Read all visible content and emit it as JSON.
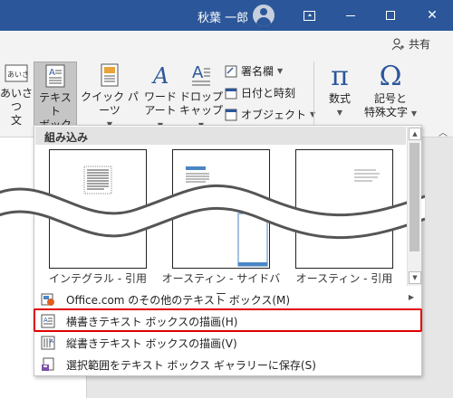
{
  "titlebar": {
    "user_name": "秋葉 一郎",
    "bg_color": "#2b579a"
  },
  "share": {
    "label": "共有",
    "icon": "person-add-icon"
  },
  "ribbon": {
    "buttons": [
      {
        "line1": "あいさつ",
        "line2": "文",
        "icon": "greeting-icon"
      },
      {
        "line1": "テキスト",
        "line2": "ボックス",
        "icon": "textbox-icon"
      },
      {
        "line1": "クイック パーツ",
        "line2": "",
        "icon": "quick-parts-icon"
      },
      {
        "line1": "ワード",
        "line2": "アート",
        "icon": "wordart-icon"
      },
      {
        "line1": "ドロップ",
        "line2": "キャップ",
        "icon": "dropcap-icon"
      }
    ],
    "small": [
      {
        "label": "署名欄",
        "icon": "signature-icon"
      },
      {
        "label": "日付と時刻",
        "icon": "calendar-icon"
      },
      {
        "label": "オブジェクト",
        "icon": "object-icon"
      }
    ],
    "equation": {
      "symbol": "π",
      "label": "数式"
    },
    "symbol": {
      "symbol": "Ω",
      "line1": "記号と",
      "line2": "特殊文字"
    }
  },
  "dropdown": {
    "header": "組み込み",
    "gallery": [
      {
        "label": "インテグラル - 引用"
      },
      {
        "label": "オースティン - サイドバー"
      },
      {
        "label": "オースティン - 引用"
      }
    ],
    "menu": [
      {
        "label": "Office.com のその他のテキスト ボックス(M)",
        "icon": "office-icon",
        "submenu": true
      },
      {
        "label": "横書きテキスト ボックスの描画(H)",
        "icon": "horizontal-textbox-icon",
        "submenu": false
      },
      {
        "label": "縦書きテキスト ボックスの描画(V)",
        "icon": "vertical-textbox-icon",
        "submenu": false
      },
      {
        "label": "選択範囲をテキスト ボックス ギャラリーに保存(S)",
        "icon": "save-selection-icon",
        "submenu": false
      }
    ]
  },
  "colors": {
    "highlight": "#e00000",
    "accent": "#2b579a"
  }
}
